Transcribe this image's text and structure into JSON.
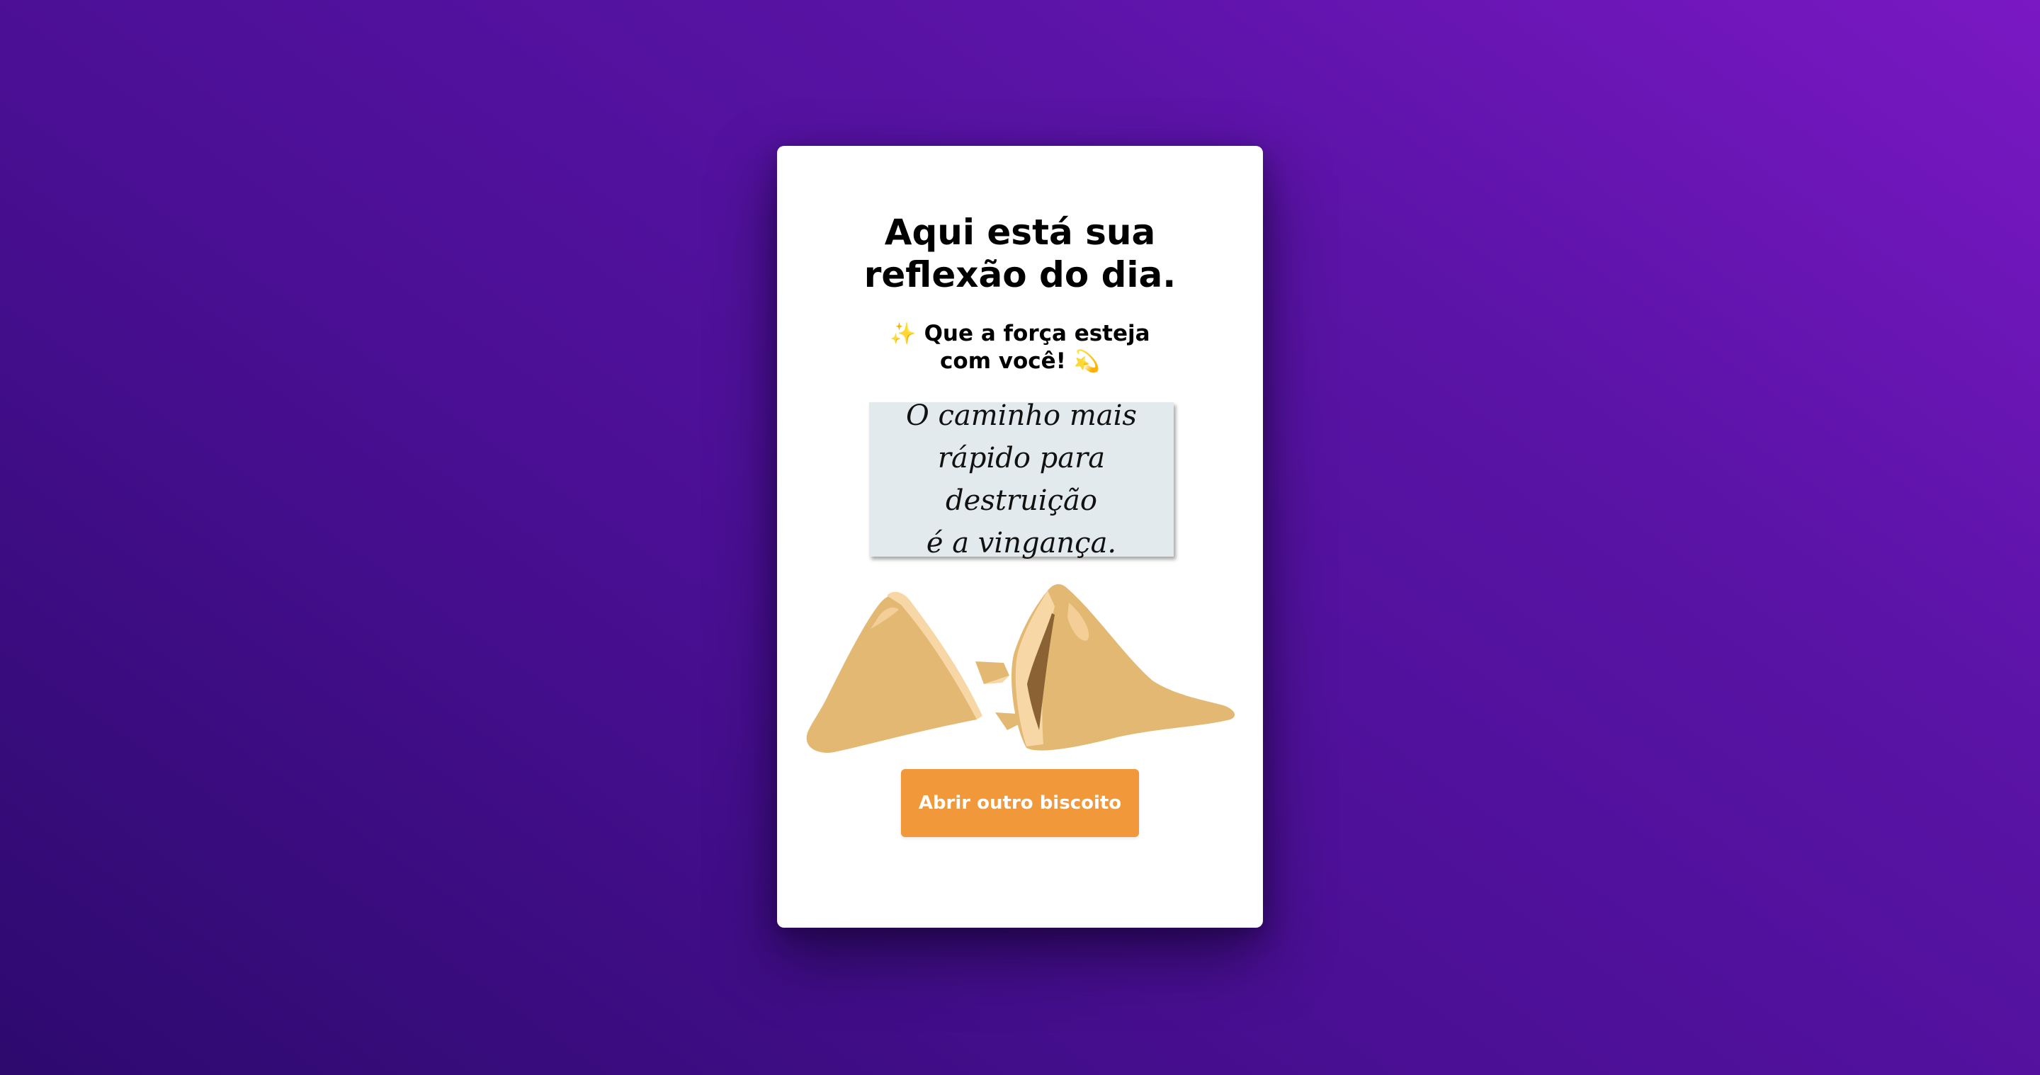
{
  "card": {
    "title_line1": "Aqui está sua",
    "title_line2": "reflexão do dia.",
    "subtitle_emoji_start": "✨",
    "subtitle_text": "Que a força esteja com você!",
    "subtitle_emoji_end": "💫",
    "quote_line1": "O caminho mais",
    "quote_line2": "rápido para destruição",
    "quote_line3": "é a vingança.",
    "illustration_icon": "broken-fortune-cookie-icon",
    "button_label": "Abrir outro biscoito"
  },
  "colors": {
    "background_start": "#2d0a6e",
    "background_end": "#7a18c4",
    "card": "#ffffff",
    "quote_box": "#e3eaee",
    "button": "#f0983a",
    "cookie": "#e2b873"
  }
}
